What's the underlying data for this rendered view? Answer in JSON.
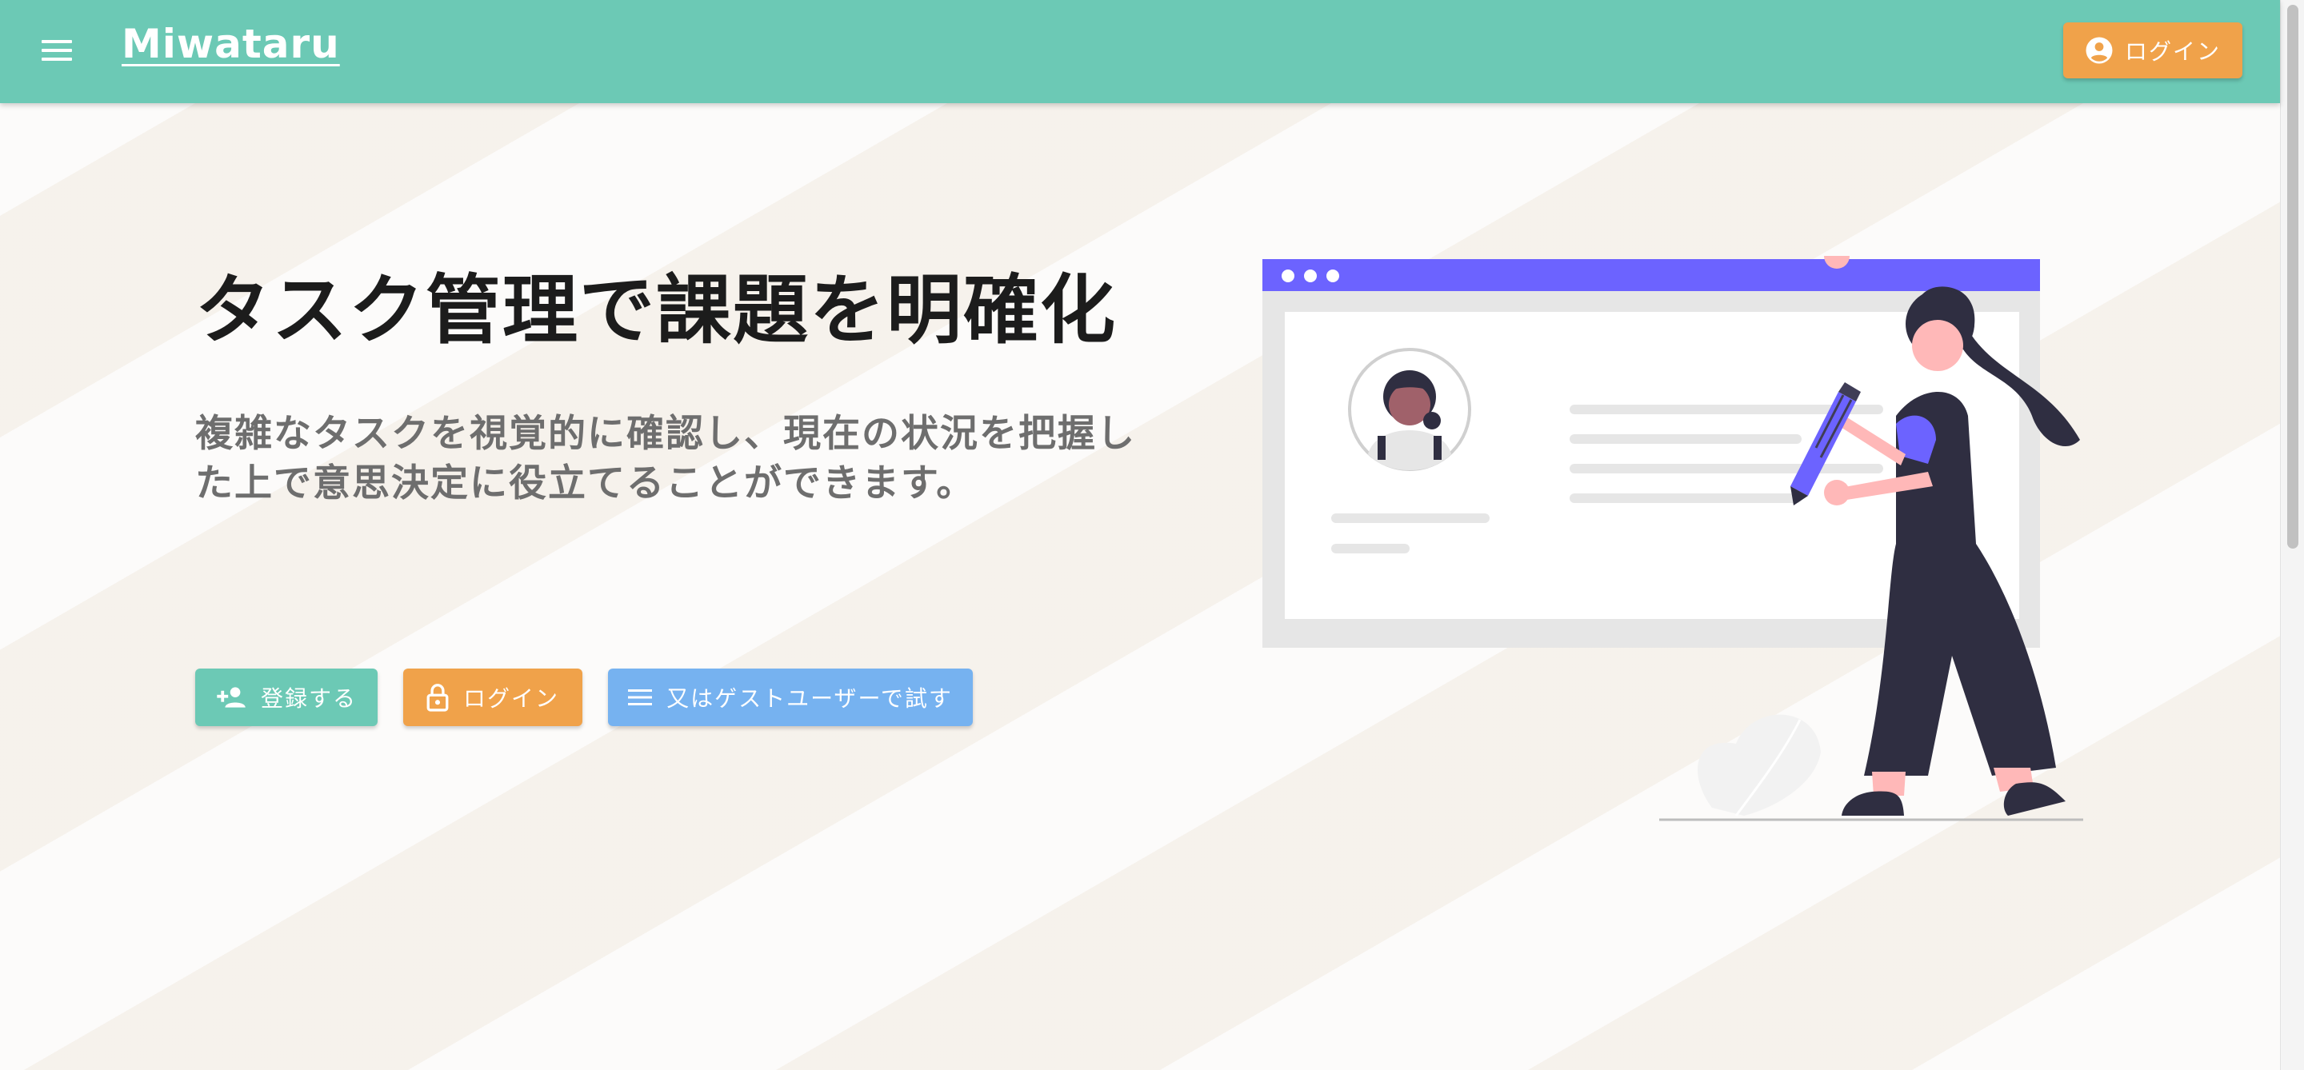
{
  "header": {
    "brand": "Miwataru",
    "login_label": "ログイン"
  },
  "hero": {
    "title": "タスク管理で課題を明確化",
    "subtitle_line1": "複雑なタスクを視覚的に確認し、現在の状況を把握し",
    "subtitle_line2": "た上で意思決定に役立てることができます。"
  },
  "actions": {
    "register_label": "登録する",
    "login_label": "ログイン",
    "guest_label": "又はゲストユーザーで試す"
  },
  "icons": {
    "menu": "menu-icon",
    "account": "account-circle-icon",
    "register": "person-add-icon",
    "login": "lock-open-icon",
    "guest": "list-icon"
  },
  "colors": {
    "primary": "#6cc9b5",
    "accent_orange": "#f0a24a",
    "accent_blue": "#76b2f0",
    "illustration_purple": "#6c63ff"
  }
}
